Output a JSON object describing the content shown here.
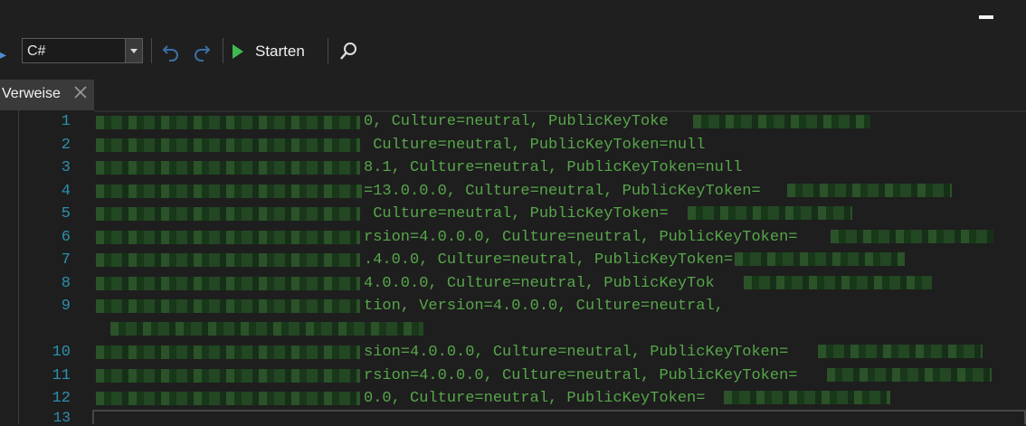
{
  "toolbar": {
    "language": "C#",
    "run_label": "Starten",
    "icons": [
      "undo-icon",
      "redo-icon",
      "play-icon",
      "search-icon"
    ]
  },
  "tab": {
    "label": "Verweise"
  },
  "colors": {
    "line_number": "#2b91af",
    "code_text": "#57a64a",
    "background": "#1e1e1e",
    "run_icon": "#3fb950"
  },
  "editor": {
    "lines": [
      {
        "num": "1",
        "text": "0, Culture=neutral, PublicKeyToke"
      },
      {
        "num": "2",
        "text": " Culture=neutral, PublicKeyToken=null"
      },
      {
        "num": "3",
        "text": "8.1, Culture=neutral, PublicKeyToken=null"
      },
      {
        "num": "4",
        "text": "=13.0.0.0, Culture=neutral, PublicKeyToken="
      },
      {
        "num": "5",
        "text": " Culture=neutral, PublicKeyToken="
      },
      {
        "num": "6",
        "text": "rsion=4.0.0.0, Culture=neutral, PublicKeyToken="
      },
      {
        "num": "7",
        "text": ".4.0.0, Culture=neutral, PublicKeyToken="
      },
      {
        "num": "8",
        "text": "4.0.0.0, Culture=neutral, PublicKeyTok"
      },
      {
        "num": "9",
        "text": "tion, Version=4.0.0.0, Culture=neutral,"
      },
      {
        "num": "",
        "text": ""
      },
      {
        "num": "10",
        "text": "sion=4.0.0.0, Culture=neutral, PublicKeyToken="
      },
      {
        "num": "11",
        "text": "rsion=4.0.0.0, Culture=neutral, PublicKeyToken="
      },
      {
        "num": "12",
        "text": "0.0, Culture=neutral, PublicKeyToken="
      },
      {
        "num": "13",
        "text": ""
      }
    ]
  }
}
